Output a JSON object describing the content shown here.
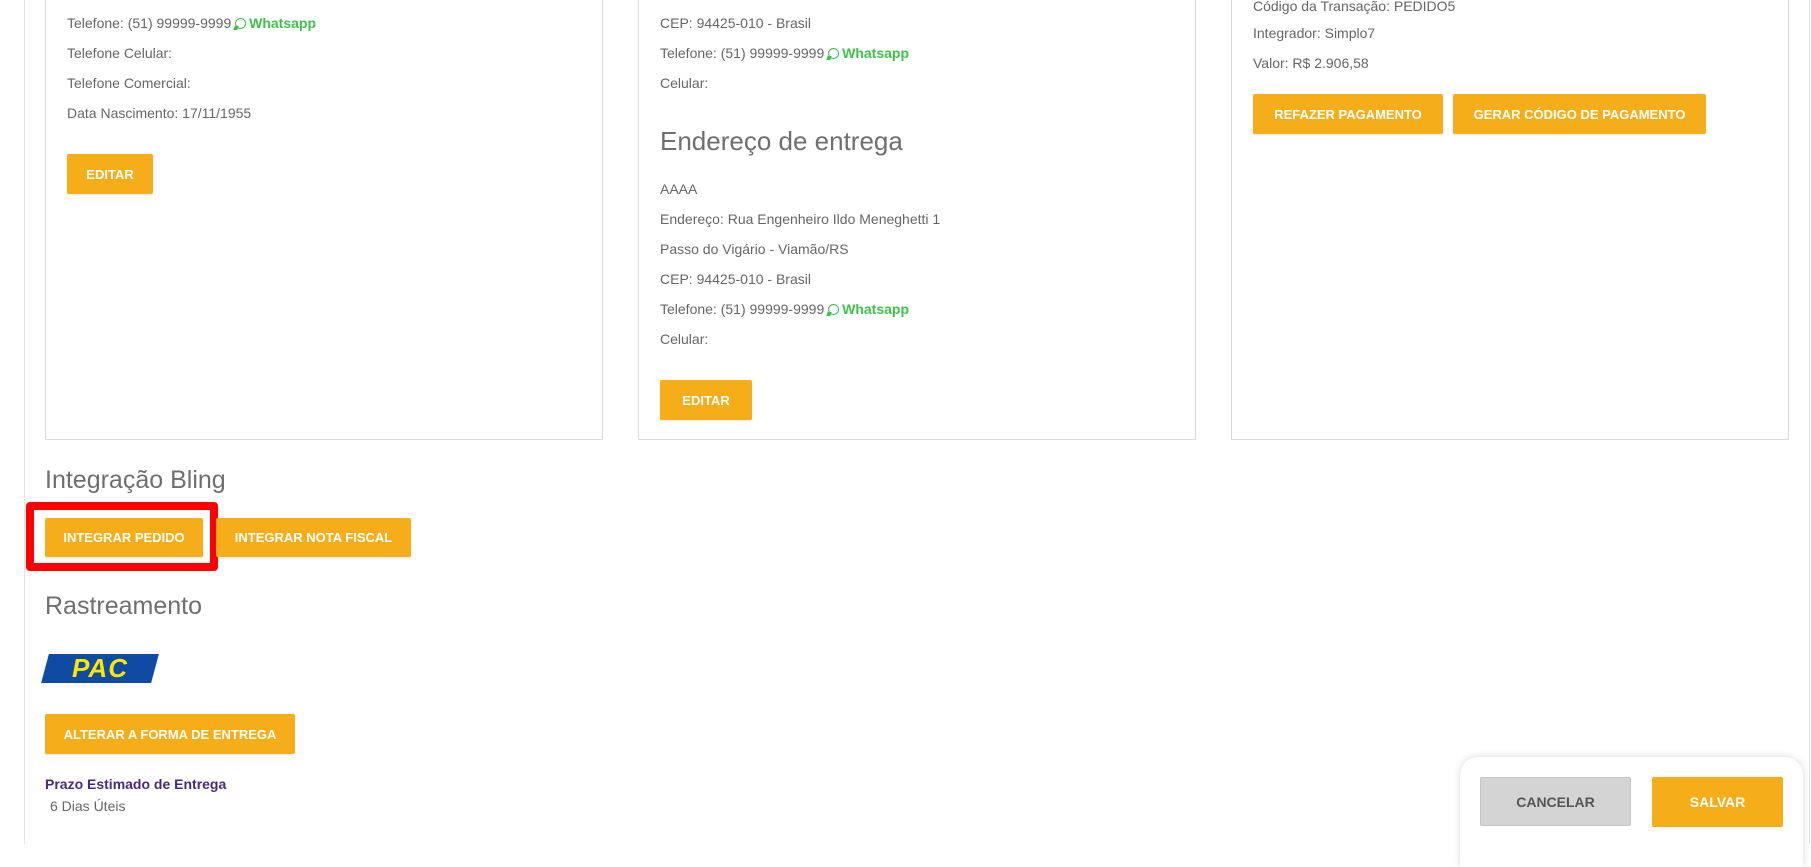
{
  "cliente": {
    "telefone": "Telefone: (51) 99999-9999",
    "whatsapp": "Whatsapp",
    "celular": "Telefone Celular:",
    "comercial": "Telefone Comercial:",
    "nascimento": "Data Nascimento: 17/11/1955",
    "editar": "EDITAR"
  },
  "cobranca": {
    "cep": "CEP: 94425-010 - Brasil",
    "telefone": "Telefone: (51) 99999-9999",
    "whatsapp": "Whatsapp",
    "celular": "Celular:"
  },
  "entrega": {
    "titulo": "Endereço de entrega",
    "nome": "AAAA",
    "endereco": "Endereço: Rua Engenheiro Ildo Meneghetti 1",
    "bairro": "Passo do Vigário - Viamão/RS",
    "cep": "CEP: 94425-010 - Brasil",
    "telefone": "Telefone: (51) 99999-9999",
    "whatsapp": "Whatsapp",
    "celular": "Celular:",
    "editar": "EDITAR"
  },
  "pagamento": {
    "transacao": "Código da Transação: PEDIDO5",
    "integrador": "Integrador: Simplo7",
    "valor": "Valor: R$ 2.906,58",
    "refazer": "REFAZER PAGAMENTO",
    "gerar": "GERAR CÓDIGO DE PAGAMENTO"
  },
  "bling": {
    "titulo": "Integração Bling",
    "integrar_pedido": "INTEGRAR PEDIDO",
    "integrar_nota": "INTEGRAR NOTA FISCAL"
  },
  "rastreamento": {
    "titulo": "Rastreamento",
    "logo_text": "PAC",
    "alterar": "ALTERAR A FORMA DE ENTREGA",
    "prazo_label": "Prazo Estimado de Entrega",
    "prazo_value": "6 Dias Úteis"
  },
  "acoes": {
    "cancelar": "CANCELAR",
    "salvar": "SALVAR"
  },
  "colors": {
    "accent": "#f5ad1a",
    "whatsapp": "#3ec24a",
    "highlight": "#ff0000",
    "pac_blue": "#0f4ba3",
    "pac_yellow": "#ffe600",
    "prazo_label": "#4a2b7a"
  }
}
